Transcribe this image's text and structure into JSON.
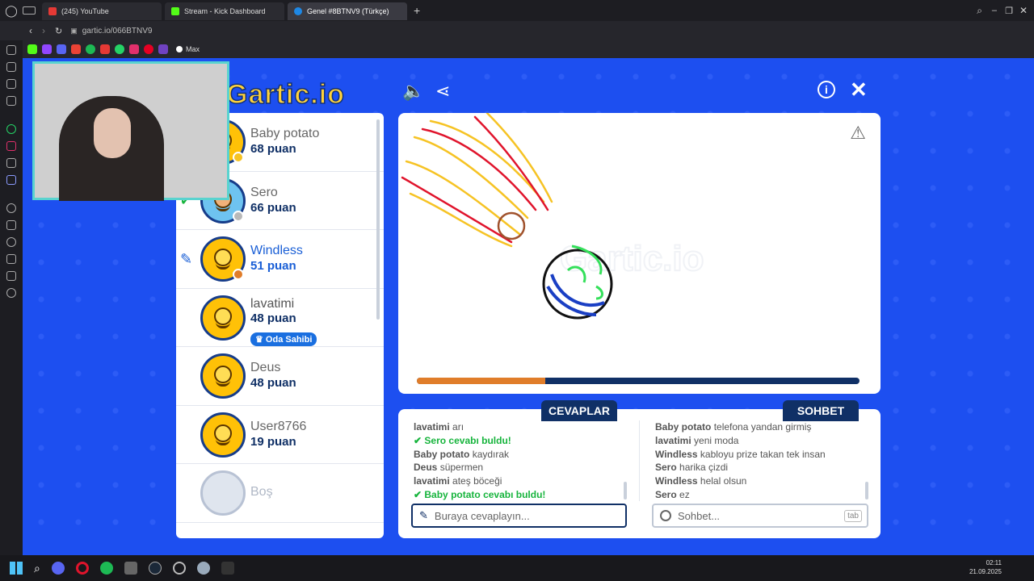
{
  "browser": {
    "tabs": [
      {
        "label": "(245) YouTube",
        "color": "#e53935"
      },
      {
        "label": "Stream - Kick Dashboard",
        "color": "#53fc18"
      },
      {
        "label": "Genel #8BTNV9 (Türkçe)",
        "color": "#1e88e5"
      }
    ],
    "url": "gartic.io/066BTNV9",
    "bookmark_max": "Max"
  },
  "game": {
    "logo": "Gartic.io",
    "players": [
      {
        "name": "Baby potato",
        "score": "68 puan",
        "dot": "#f6c324"
      },
      {
        "name": "Sero",
        "score": "66 puan",
        "dot": "#b9b9b9"
      },
      {
        "name": "Windless",
        "score": "51 puan",
        "dot": "#e07d2a",
        "drawing": true
      },
      {
        "name": "lavatimi",
        "score": "48 puan",
        "badge": "Oda Sahibi"
      },
      {
        "name": "Deus",
        "score": "48 puan"
      },
      {
        "name": "User8766",
        "score": "19 puan"
      },
      {
        "name": "Boş",
        "score": ""
      }
    ],
    "progress": 0.29,
    "answers_tab": "CEVAPLAR",
    "chat_tab": "SOHBET",
    "answers_log": [
      {
        "user": "lavatimi",
        "text": "arı"
      },
      {
        "user": "Sero",
        "text": "cevabı buldu!",
        "correct": true
      },
      {
        "user": "Baby potato",
        "text": "kaydırak"
      },
      {
        "user": "Deus",
        "text": "süpermen"
      },
      {
        "user": "lavatimi",
        "text": "ateş böceği"
      },
      {
        "user": "Baby potato",
        "text": "cevabı buldu!",
        "correct": true
      }
    ],
    "chat_log": [
      {
        "user": "Baby potato",
        "text": "telefona yandan girmiş"
      },
      {
        "user": "lavatimi",
        "text": "yeni moda"
      },
      {
        "user": "Windless",
        "text": "kabloyu prize takan tek insan"
      },
      {
        "user": "Sero",
        "text": "harika çizdi"
      },
      {
        "user": "Windless",
        "text": "helal olsun"
      },
      {
        "user": "Sero",
        "text": "ez"
      }
    ],
    "answer_placeholder": "Buraya cevaplayın...",
    "chat_placeholder": "Sohbet...",
    "chat_key": "tab"
  },
  "taskbar": {
    "time": "02:11",
    "date": "21.09.2025"
  }
}
